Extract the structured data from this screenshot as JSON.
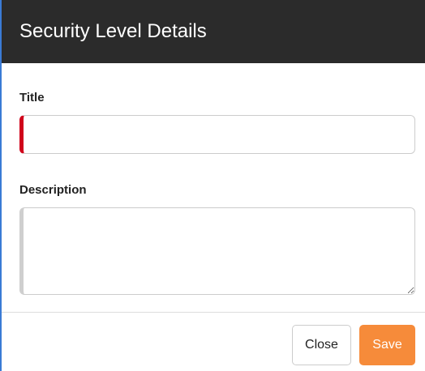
{
  "dialog": {
    "title": "Security Level Details"
  },
  "form": {
    "title_label": "Title",
    "title_value": "",
    "description_label": "Description",
    "description_value": ""
  },
  "footer": {
    "close_label": "Close",
    "save_label": "Save"
  },
  "colors": {
    "header_bg": "#2b2b2b",
    "required_indicator": "#d0021b",
    "save_button": "#f68b3a",
    "window_border": "#3a7bd5"
  }
}
